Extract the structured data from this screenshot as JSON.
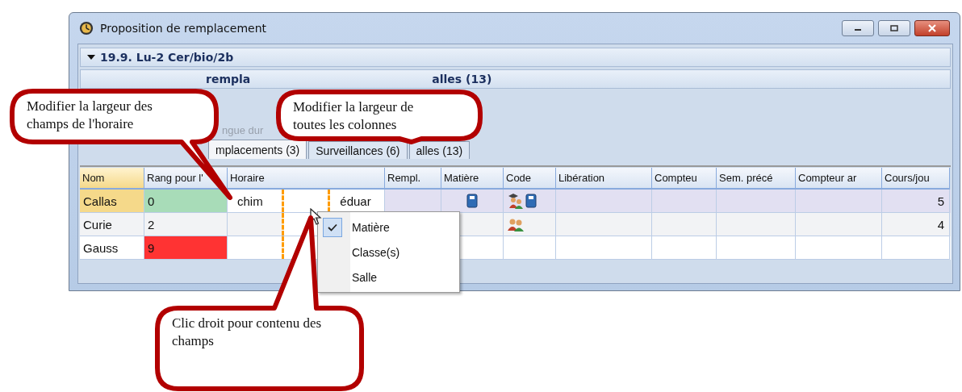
{
  "window": {
    "title": "Proposition de remplacement"
  },
  "lesson_row": {
    "text": "19.9. Lu-2 Cer/bio/2b",
    "expanded": true
  },
  "summary_row": {
    "segments": [
      "rempla",
      "alles (13)"
    ]
  },
  "option_text": "ngue dur",
  "tabs": [
    {
      "label": "mplacements (3)",
      "selected": true
    },
    {
      "label": "Surveillances (6)",
      "selected": false
    },
    {
      "label": "alles (13)",
      "selected": false
    }
  ],
  "columns": [
    "Nom",
    "Rang pour l'",
    "Horaire",
    "Rempl.",
    "Matière",
    "Code",
    "Libération",
    "Compteu",
    "Sem. précé",
    "Compteur ar",
    "Cours/jou"
  ],
  "rows": [
    {
      "name": "Callas",
      "rank": "0",
      "color": "#a8dcb8",
      "selected": true,
      "schedule_start": "chim",
      "schedule_end": "éduar",
      "subject_icons": [
        {
          "kind": "book"
        }
      ],
      "code_icons": [
        {
          "kind": "teacher"
        },
        {
          "kind": "book"
        }
      ],
      "lessons": "5"
    },
    {
      "name": "Curie",
      "rank": "2",
      "selected": false,
      "code_icons": [
        {
          "kind": "group"
        }
      ],
      "lessons": "4"
    },
    {
      "name": "Gauss",
      "rank": "9",
      "color": "#ff3333",
      "selected": false
    }
  ],
  "context_menu": [
    {
      "label": "Matière",
      "checked": true
    },
    {
      "label": "Classe(s)",
      "checked": false
    },
    {
      "label": "Salle",
      "checked": false
    }
  ],
  "callouts": [
    {
      "text": "Modifier la largeur des champs de l'horaire"
    },
    {
      "text": "Modifier la largeur de toutes les colonnes"
    },
    {
      "text": "Clic droit pour contenu des champs"
    }
  ]
}
